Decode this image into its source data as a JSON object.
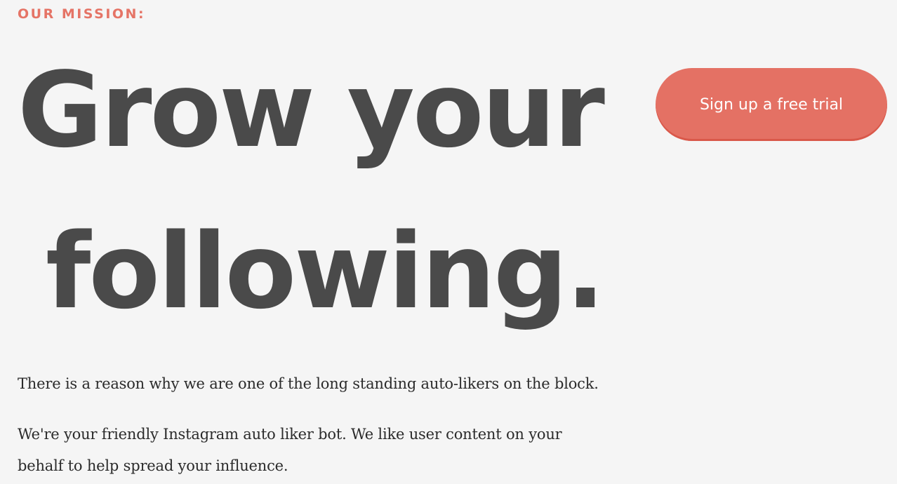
{
  "hero": {
    "eyebrow": "OUR MISSION:",
    "headline_line_1": "Grow your",
    "headline_line_2": "following."
  },
  "cta": {
    "label": "Sign up a free trial"
  },
  "content": {
    "paragraph_1": "There is a reason why we are one of the long standing auto-likers on the block.",
    "paragraph_2": "We're your friendly Instagram auto liker bot. We like user content on your behalf to help spread your influence."
  },
  "colors": {
    "accent": "#e57466",
    "headline": "#4a4a4a",
    "body_text": "#2b2b2b",
    "background": "#f5f5f5"
  }
}
